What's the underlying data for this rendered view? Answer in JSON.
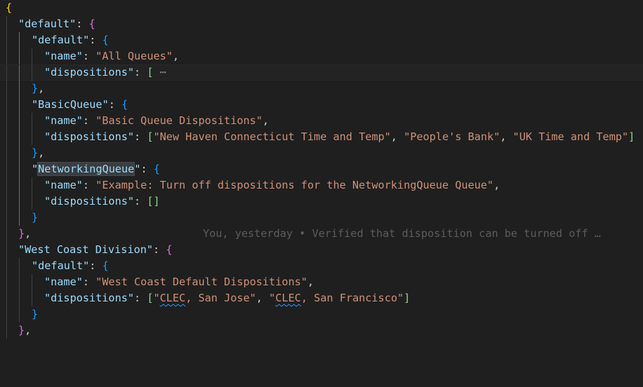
{
  "editor": {
    "language": "json",
    "blame": "You, yesterday • Verified that disposition can be turned off …",
    "fold_marker": "⋯",
    "lines": [
      {
        "text": "{"
      },
      {
        "key": "\"default\""
      },
      {
        "key": "\"default\""
      },
      {
        "key": "\"name\"",
        "value": "\"All Queues\""
      },
      {
        "key": "\"dispositions\""
      },
      {
        "text": "},"
      },
      {
        "key": "\"BasicQueue\""
      },
      {
        "key": "\"name\"",
        "value": "\"Basic Queue Dispositions\""
      },
      {
        "key": "\"dispositions\"",
        "items": [
          "\"New Haven Connecticut Time and Temp\"",
          "\"People's Bank\"",
          "\"UK Time and Temp\""
        ]
      },
      {
        "text": "},"
      },
      {
        "key": "\"NetworkingQueue\"",
        "highlight": "NetworkingQueue"
      },
      {
        "key": "\"name\"",
        "value": "\"Example: Turn off dispositions for the NetworkingQueue Queue\""
      },
      {
        "key": "\"dispositions\"",
        "value": "[]"
      },
      {
        "text": "}"
      },
      {
        "text": "},"
      },
      {
        "key": "\"West Coast Division\""
      },
      {
        "key": "\"default\""
      },
      {
        "key": "\"name\"",
        "value": "\"West Coast Default Dispositions\""
      },
      {
        "key": "\"dispositions\"",
        "items": [
          "\"CLEC, San Jose\"",
          "\"CLEC, San Francisco\""
        ],
        "squiggle": "CLEC"
      },
      {
        "text": "}"
      },
      {
        "text": "},"
      }
    ]
  },
  "colors": {
    "background": "#1f1f1f",
    "key": "#9cdcfe",
    "string": "#ce9178",
    "bracket_gold": "#ffd700",
    "bracket_orchid": "#da70d6",
    "bracket_blue": "#179fff",
    "bracket_green": "#8bd88b"
  }
}
